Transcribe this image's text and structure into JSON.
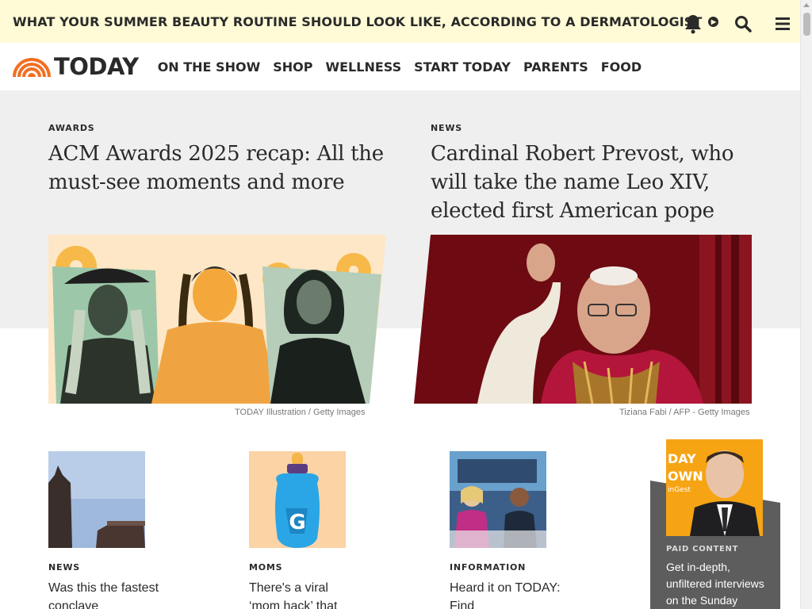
{
  "banner": {
    "text": "WHAT YOUR SUMMER BEAUTY ROUTINE SHOULD LOOK LIKE, ACCORDING TO A DERMATOLOGIST",
    "arrow_icon": "chevron-right-circle-icon"
  },
  "nav": {
    "logo_text": "TODAY",
    "links": [
      "ON THE SHOW",
      "SHOP",
      "WELLNESS",
      "START TODAY",
      "PARENTS",
      "FOOD"
    ],
    "icons": [
      "bell-icon",
      "search-icon",
      "hamburger-menu-icon"
    ]
  },
  "hero": {
    "left": {
      "eyebrow": "AWARDS",
      "headline": "ACM Awards 2025 recap: All the must-see moments and more",
      "credit": "TODAY Illustration / Getty Images"
    },
    "right": {
      "eyebrow": "NEWS",
      "headline": "Cardinal Robert Prevost, who will take the name Leo XIV, elected first American pope",
      "credit": "Tiziana Fabi / AFP - Getty Images"
    }
  },
  "cards": [
    {
      "eyebrow": "NEWS",
      "title": "Was this the fastest conclave"
    },
    {
      "eyebrow": "MOMS",
      "title": "There's a viral ‘mom hack’ that"
    },
    {
      "eyebrow": "INFORMATION",
      "title": "Heard it on TODAY: Find"
    }
  ],
  "paid": {
    "label": "PAID CONTENT",
    "text": "Get in-depth, unfiltered interviews on the Sunday",
    "thumb_text": [
      "DAY",
      "OWN",
      "inGest"
    ]
  },
  "colors": {
    "banner_bg": "#fffbd6",
    "logo_orange": "#f36f21",
    "hero_bg": "#efefef",
    "paid_bg": "#5d5d5d"
  }
}
